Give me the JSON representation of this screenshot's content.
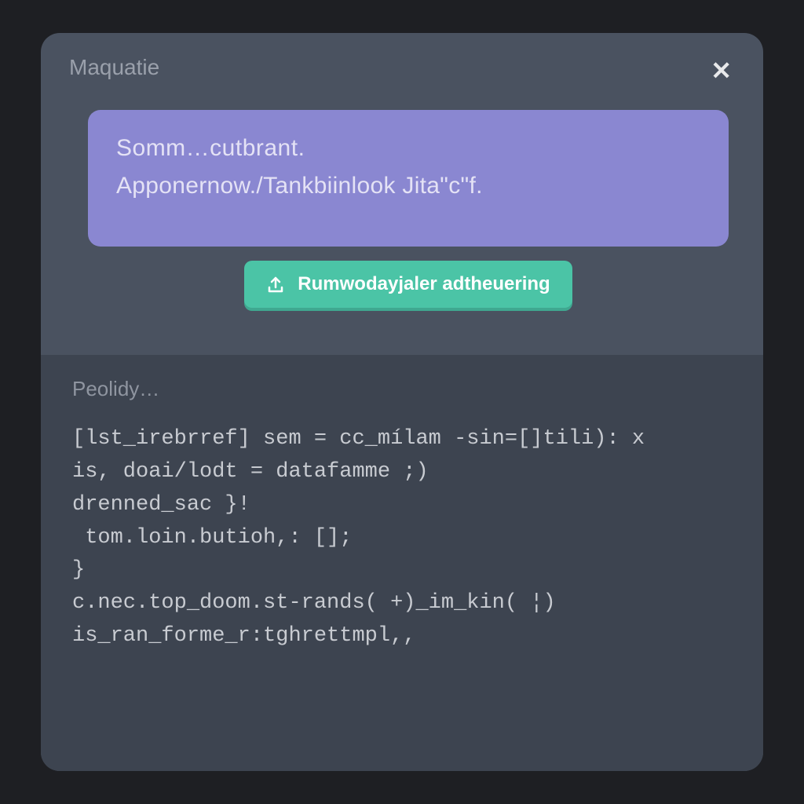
{
  "modal": {
    "title": "Maquatie",
    "close_label": "✕"
  },
  "info": {
    "line1": "Somm…cutbrant.",
    "line2": "Apponernow./Tankbiinlook Jita\"c\"f."
  },
  "action": {
    "button_label": "Rumwodayjaler adtheuering"
  },
  "output": {
    "label": "Peolidy…",
    "code": "[lst_irebrref] sem = cc_mílam -sin=[]tili): x\nis, doai/lodt = datafamme ;)\ndrenned_sac }!\n tom.loin.butioh,: [];\n}\nc.nec.top_doom.st-rands( +)_im_kin( ¦)\nis_ran_forme_r:tghrettmpl,,"
  }
}
